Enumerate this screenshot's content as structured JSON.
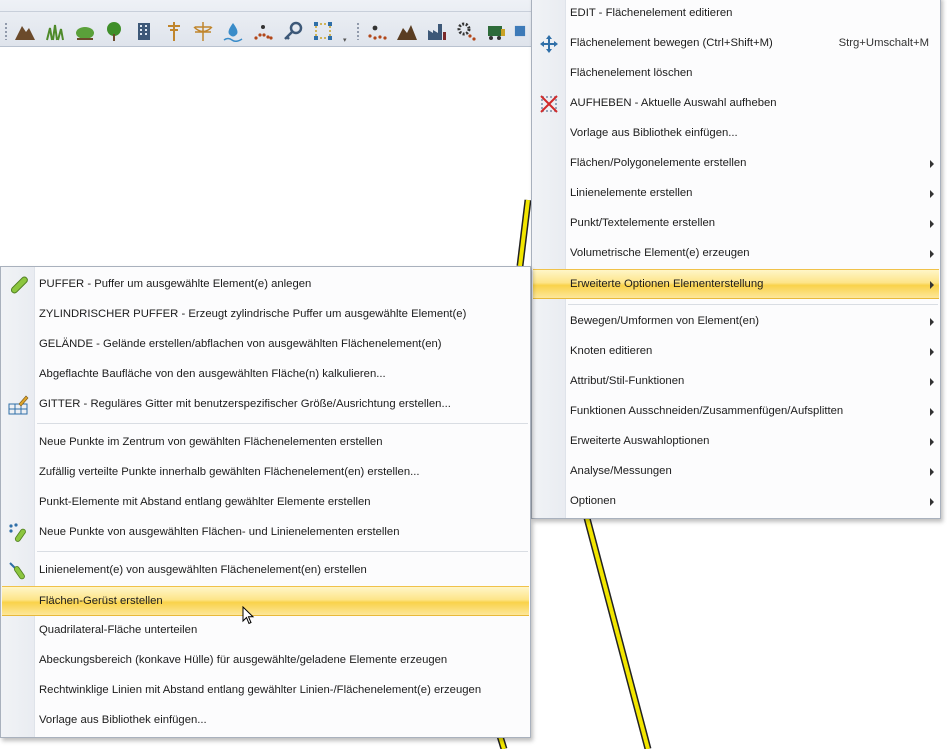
{
  "colors": {
    "highlight": "#fbd84e",
    "road": "#f2e600",
    "menu_bg": "#fcfcfd",
    "gutter": "#eceff3"
  },
  "toolbar": {
    "icons": [
      "mountain-icon",
      "grass-icon",
      "bush-icon",
      "tree-icon",
      "building-icon",
      "power-pole-icon",
      "power-line-icon",
      "water-drop-icon",
      "dotted-path-icon",
      "key-icon",
      "node-grid-icon",
      "scatter-points-icon",
      "terrain-icon",
      "factory-icon",
      "gear-points-icon",
      "vehicle-icon"
    ]
  },
  "main_menu": {
    "items": [
      {
        "label": "EDIT - Flächenelement editieren",
        "icon": "",
        "submenu": false
      },
      {
        "label": "Flächenelement bewegen (Ctrl+Shift+M)",
        "shortcut": "Strg+Umschalt+M",
        "icon": "move-arrows-icon",
        "submenu": false
      },
      {
        "label": "Flächenelement löschen",
        "icon": "",
        "submenu": false
      },
      {
        "label": "AUFHEBEN - Aktuelle Auswahl aufheben",
        "icon": "clear-selection-icon",
        "submenu": false
      },
      {
        "label": "Vorlage aus Bibliothek einfügen...",
        "icon": "",
        "submenu": false
      },
      {
        "label": "Flächen/Polygonelemente erstellen",
        "icon": "",
        "submenu": true
      },
      {
        "label": "Linienelemente erstellen",
        "icon": "",
        "submenu": true
      },
      {
        "label": "Punkt/Textelemente erstellen",
        "icon": "",
        "submenu": true
      },
      {
        "label": "Volumetrische Element(e) erzeugen",
        "icon": "",
        "submenu": true
      },
      {
        "label": "Erweiterte Optionen Elementerstellung",
        "icon": "",
        "submenu": true,
        "highlighted": true
      },
      {
        "label": "Bewegen/Umformen von Element(en)",
        "icon": "",
        "submenu": true
      },
      {
        "label": "Knoten editieren",
        "icon": "",
        "submenu": true
      },
      {
        "label": "Attribut/Stil-Funktionen",
        "icon": "",
        "submenu": true
      },
      {
        "label": "Funktionen Ausschneiden/Zusammenfügen/Aufsplitten",
        "icon": "",
        "submenu": true
      },
      {
        "label": "Erweiterte Auswahloptionen",
        "icon": "",
        "submenu": true
      },
      {
        "label": "Analyse/Messungen",
        "icon": "",
        "submenu": true
      },
      {
        "label": "Optionen",
        "icon": "",
        "submenu": true
      }
    ]
  },
  "sub_menu": {
    "items": [
      {
        "label": "PUFFER - Puffer um ausgewählte Element(e) anlegen",
        "icon": "buffer-icon"
      },
      {
        "label": "ZYLINDRISCHER PUFFER - Erzeugt zylindrische Puffer um ausgewählte Element(e)",
        "icon": ""
      },
      {
        "label": "GELÄNDE - Gelände erstellen/abflachen von ausgewählten Flächenelement(en)",
        "icon": ""
      },
      {
        "label": "Abgeflachte Baufläche von den ausgewählten Fläche(n) kalkulieren...",
        "icon": ""
      },
      {
        "label": "GITTER - Reguläres Gitter mit benutzerspezifischer Größe/Ausrichtung erstellen...",
        "icon": "grid-pencil-icon"
      },
      {
        "label": "Neue Punkte im Zentrum von gewählten Flächenelementen erstellen",
        "icon": ""
      },
      {
        "label": "Zufällig verteilte Punkte innerhalb gewählten Flächenelement(en) erstellen...",
        "icon": ""
      },
      {
        "label": "Punkt-Elemente mit Abstand entlang gewählter Elemente erstellen",
        "icon": ""
      },
      {
        "label": "Neue Punkte von ausgewählten Flächen- und Linienelementen erstellen",
        "icon": "points-from-lines-icon"
      },
      {
        "label": "Linienelement(e) von ausgewählten Flächenelement(en) erstellen",
        "icon": "lines-from-areas-icon"
      },
      {
        "label": "Flächen-Gerüst erstellen",
        "icon": "",
        "highlighted": true
      },
      {
        "label": "Quadrilateral-Fläche unterteilen",
        "icon": ""
      },
      {
        "label": "Abeckungsbereich (konkave Hülle) für ausgewählte/geladene Elemente erzeugen",
        "icon": ""
      },
      {
        "label": "Rechtwinklige Linien mit Abstand entlang gewählter Linien-/Flächenelement(e) erzeugen",
        "icon": ""
      },
      {
        "label": "Vorlage aus Bibliothek einfügen...",
        "icon": ""
      }
    ]
  }
}
